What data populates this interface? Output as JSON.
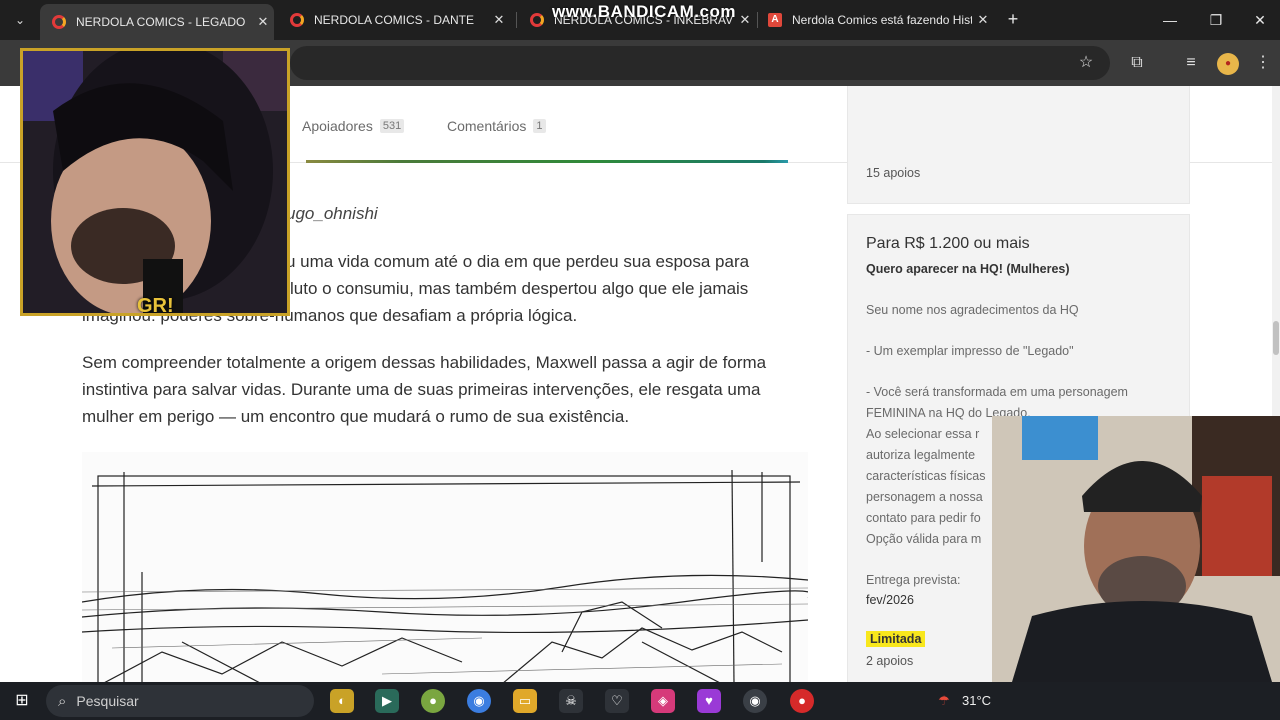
{
  "browser": {
    "tabs": [
      {
        "title": "NERDOLA COMICS - LEGADO",
        "active": true
      },
      {
        "title": "NERDOLA COMICS - DANTE",
        "active": false
      },
      {
        "title": "NERDOLA COMICS - INKEBRAVEL",
        "active": false
      },
      {
        "title": "Nerdola Comics está fazendo Hist",
        "active": false
      }
    ],
    "watermark": "www.BANDICAM.com"
  },
  "page": {
    "nav": [
      {
        "label": "Apoiadores",
        "count": "531"
      },
      {
        "label": "Comentários",
        "count": "1"
      }
    ],
    "credit": "ugo_ohnishi",
    "paragraph1": [
      "u uma vida comum até o dia em que perdeu sua esposa para",
      "luto o consumiu, mas também despertou algo que ele jamais",
      "imaginou: poderes sobre-humanos que desafiam a própria lógica."
    ],
    "paragraph2": [
      "Sem compreender totalmente a origem dessas habilidades, Maxwell passa a agir de forma",
      "instintiva para salvar vidas. Durante uma de suas primeiras intervenções, ele resgata uma",
      "mulher em perigo — um encontro que mudará o rumo de sua existência."
    ]
  },
  "rewards": {
    "previous_supports": "15 apoios",
    "title": "Para R$ 1.200 ou mais",
    "subtitle": "Quero aparecer na HQ! (Mulheres)",
    "items": [
      "Seu nome nos agradecimentos da HQ",
      "- Um exemplar impresso de \"Legado\"",
      "- Você será transformada em uma personagem",
      "FEMININA na HQ do Legado.",
      "Ao selecionar essa r",
      "autoriza legalmente",
      "características físicas",
      "personagem a nossa",
      "contato para pedir fo",
      "Opção válida para m"
    ],
    "delivery_label": "Entrega prevista:",
    "delivery_date": "fev/2026",
    "badge": "Limitada",
    "supports": "2 apoios"
  },
  "overlay": {
    "cam_logo": "GR!"
  },
  "taskbar": {
    "search_placeholder": "Pesquisar",
    "temperature": "31°C"
  }
}
